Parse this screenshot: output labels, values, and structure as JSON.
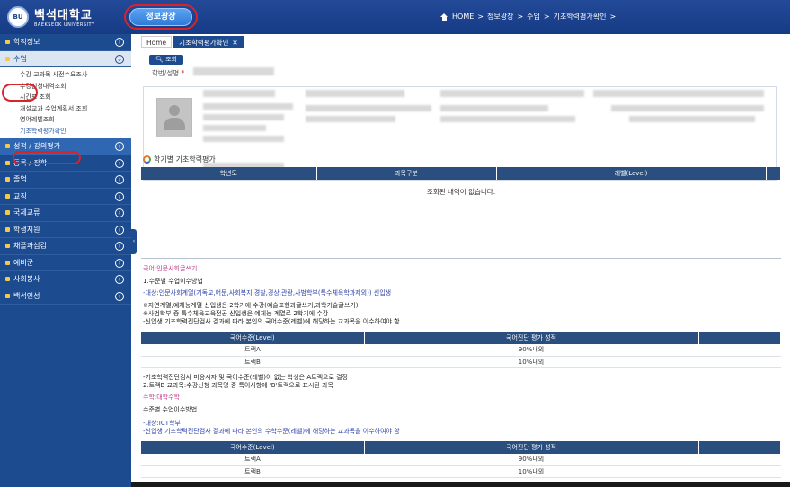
{
  "header": {
    "logo_mark": "BU",
    "logo_kr": "백석대학교",
    "logo_en": "BAEKSEOK UNIVERSITY",
    "info_button": "정보광장",
    "breadcrumb": [
      "HOME",
      ">",
      "정보광장",
      ">",
      "수업",
      ">",
      "기초학력평가확인",
      ">"
    ]
  },
  "sidebar": {
    "items_before": [
      {
        "label": "학적정보"
      }
    ],
    "active": {
      "label": "수업"
    },
    "subitems": [
      "수강 교과목 사전수요조사",
      "수강신청내역조회",
      "시간표 조회",
      "개설교과 수업계획서 조회",
      "영어레벨조회",
      "기초학력평가확인"
    ],
    "items_after": [
      {
        "label": "성적 / 강의평가"
      },
      {
        "label": "등록 / 장학"
      },
      {
        "label": "졸업"
      },
      {
        "label": "교직"
      },
      {
        "label": "국제교류"
      },
      {
        "label": "학생지원"
      },
      {
        "label": "채플과섬김"
      },
      {
        "label": "예비군"
      },
      {
        "label": "사회봉사"
      },
      {
        "label": "백석인성"
      }
    ],
    "collapse_glyph": "‹"
  },
  "tabs": [
    {
      "label": "Home"
    },
    {
      "label": "기초학력평가확인",
      "close": "✕"
    }
  ],
  "search": {
    "button": "조회",
    "label": "학번/성명",
    "required": "*"
  },
  "section_title": "학기별 기초학력평가",
  "table1": {
    "headers": [
      "학년도",
      "과목구분",
      "레벨(Level)",
      ""
    ],
    "empty_message": "조회된 내역이 없습니다."
  },
  "korean": {
    "title": "국어:인문사회글쓰기",
    "line1": "1.수준별 수업이수방법",
    "target": "-대상:인문사회계열(기독교,어문,사회복지,경찰,경상,관광,사범학부(특수체육학과제외)) 신입생",
    "note1": "※자연계열,예체능계열 신입생은 2학기에 수강(예술표현과글쓰기,과학기술글쓰기)",
    "note2": "※사범학부 중 특수체육교육전공 신입생은 예체능 계열로 2학기에 수강",
    "note3": "-신입생 기초학력진단검사 결과에 따라 본인의 국어수준(레벨)에 해당하는 교과목을 이수하여야 함",
    "headers": [
      "국어수준(Level)",
      "국어진단 평가 성적",
      ""
    ],
    "rows": [
      [
        "트랙A",
        "90%내외"
      ],
      [
        "트랙B",
        "10%내외"
      ]
    ],
    "after1": "-기초학력진단검사 미응시자 및 국어수준(레벨)이 없는 학생은 A트랙으로 결정",
    "after2": "2.트랙B 교과목:수강신청 과목명 중 특이사항에 'B'트랙으로 표시된 과목"
  },
  "math": {
    "title": "수학:대학수학",
    "line1": "수준별 수업이수방법",
    "target": "-대상:ICT학부",
    "note": "-신입생 기초학력진단검사 결과에 따라 본인의 수학수준(레벨)에 해당하는 교과목을 이수하여야 함",
    "headers": [
      "국어수준(Level)",
      "국어진단 평가 성적",
      ""
    ],
    "rows": [
      [
        "트랙A",
        "90%내외"
      ],
      [
        "트랙B",
        "10%내외"
      ]
    ]
  },
  "colors": {
    "header_blue": "#1a3f8c",
    "sidebar_blue": "#1d4b8f",
    "table_header": "#2a4f7f",
    "highlight_ring": "#d8232a",
    "pink_text": "#c2408d"
  }
}
